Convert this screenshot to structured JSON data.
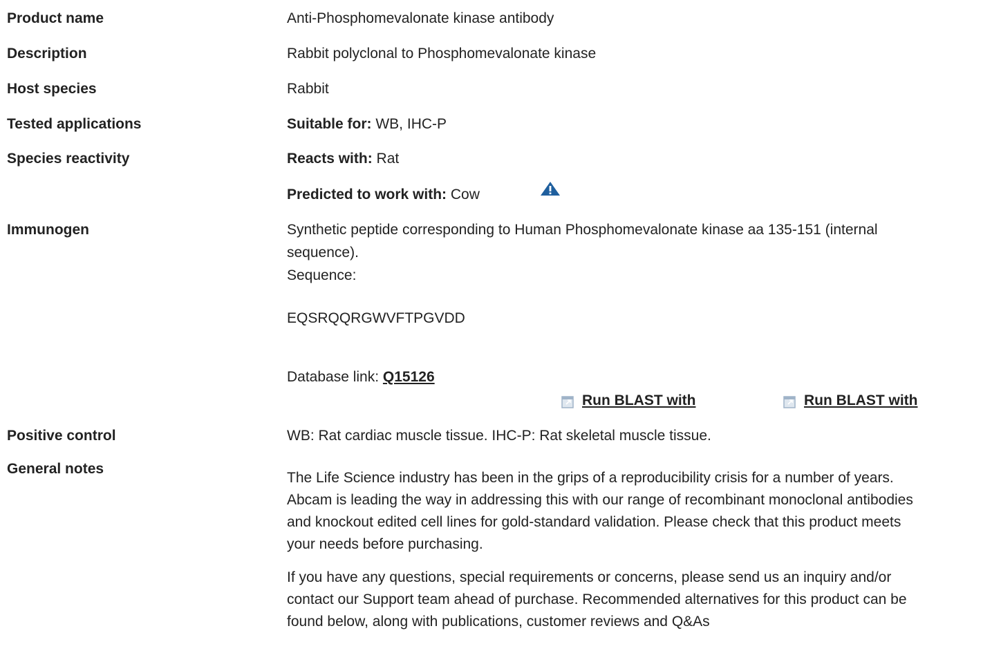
{
  "rows": {
    "product_name": {
      "label": "Product name",
      "value": "Anti-Phosphomevalonate kinase antibody"
    },
    "description": {
      "label": "Description",
      "value": "Rabbit polyclonal to Phosphomevalonate kinase"
    },
    "host_species": {
      "label": "Host species",
      "value": "Rabbit"
    },
    "tested_applications": {
      "label": "Tested applications",
      "prefix": "Suitable for:",
      "value": "WB, IHC-P"
    },
    "species_reactivity": {
      "label": "Species reactivity",
      "reacts_prefix": "Reacts with:",
      "reacts_value": "Rat",
      "predicted_prefix": "Predicted to work with:",
      "predicted_value": "Cow",
      "warning_icon": "warning-triangle-icon"
    },
    "immunogen": {
      "label": "Immunogen",
      "line1": "Synthetic peptide corresponding to Human Phosphomevalonate kinase aa 135-151 (internal",
      "line2": "sequence).",
      "sequence_label": "Sequence:",
      "sequence": "EQSRQQRGWVFTPGVDD",
      "database_prefix": "Database link:",
      "database_link": "Q15126",
      "blast_1": "Run BLAST with",
      "blast_2": "Run BLAST with",
      "blast_icon": "external-link-icon"
    },
    "positive_control": {
      "label": "Positive control",
      "value": "WB: Rat cardiac muscle tissue. IHC-P: Rat skeletal muscle tissue."
    },
    "general_notes": {
      "label": "General notes",
      "p1": [
        "The Life Science industry has been in the grips of a reproducibility crisis for a number of years.",
        "Abcam is leading the way in addressing this with our range of recombinant monoclonal antibodies",
        "and knockout edited cell lines for gold-standard validation. Please check that this product meets",
        "your needs before purchasing."
      ],
      "p2": [
        "If you have any questions, special requirements or concerns, please send us an inquiry and/or",
        "contact our Support team ahead of purchase. Recommended alternatives for this product can be",
        "found below, along with publications, customer reviews and Q&As"
      ]
    }
  },
  "colors": {
    "text": "#222222",
    "warning_icon": "#1f5f9e",
    "blast_icon": "#9fb3c8"
  }
}
